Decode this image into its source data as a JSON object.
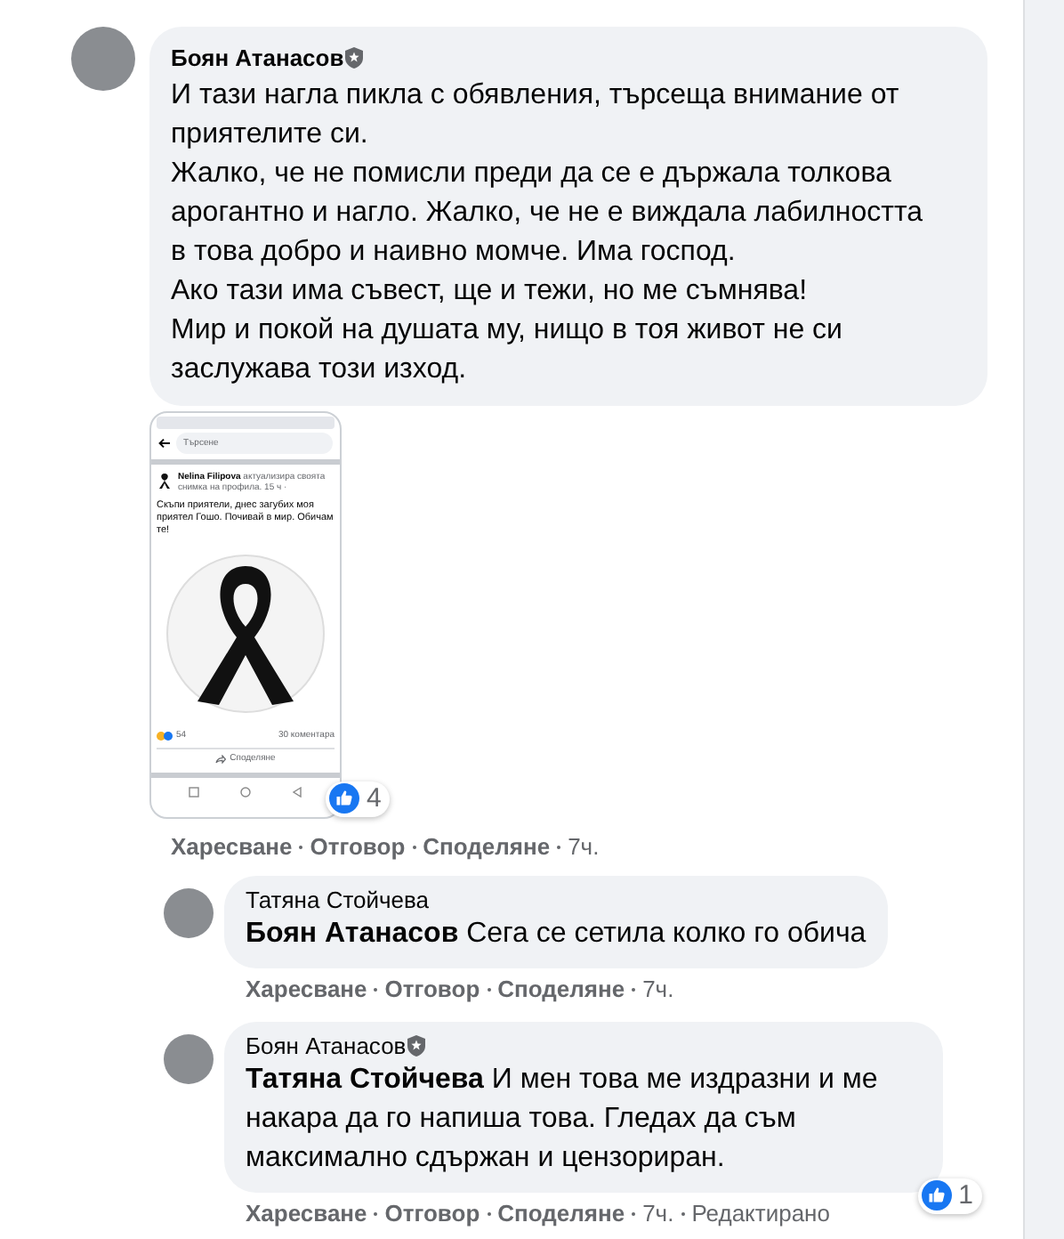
{
  "comment": {
    "author": "Боян Атанасов",
    "verified": true,
    "paragraphs": [
      "И тази нагла пикла с обявления, търсеща внимание от приятелите си.",
      "Жалко, че не помисли преди да се е държала толкова арогантно и нагло. Жалко, че не е виждала лабилността в това добро и наивно момче. Има господ.",
      "Ако тази има съвест, ще и тежи, но ме съмнява!",
      "Мир и покой на душата му, нищо в тоя живот не си заслужава този изход."
    ],
    "attachment": {
      "search_placeholder": "Търсене",
      "post_author": "Nelina Filipova",
      "post_action": "актуализира своята снимка на профила.",
      "post_time": "15 ч ·",
      "post_text": "Скъпи приятели, днес загубих моя приятел Гошо. Почивай в мир. Обичам те!",
      "reaction_count": "54",
      "comment_count": "30 коментара",
      "share_label": "Споделяне"
    },
    "reaction_count": "4",
    "actions": [
      "Харесване",
      "Отговор",
      "Споделяне"
    ],
    "time": "7ч."
  },
  "replies": [
    {
      "author": "Татяна Стойчева",
      "verified": false,
      "text": "**Боян Атанасов** Сега се сетила колко го обича",
      "actions": [
        "Харесване",
        "Отговор",
        "Споделяне"
      ],
      "time": "7ч."
    },
    {
      "author": "Боян Атанасов",
      "verified": true,
      "text": "**Татяна Стойчева** И мен това ме издразни и ме накара да го напиша това. Гледах да съм максимално сдържан и цензориран.",
      "reaction_count": "1",
      "actions": [
        "Харесване",
        "Отговор",
        "Споделяне"
      ],
      "time": "7ч.",
      "edited": "Редактирано"
    }
  ]
}
